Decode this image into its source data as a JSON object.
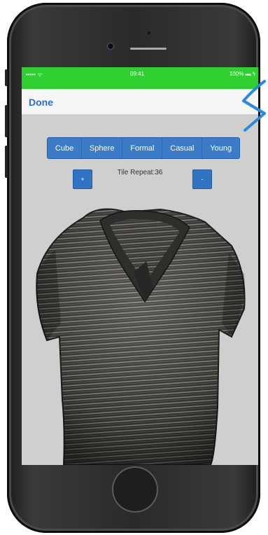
{
  "status_bar": {
    "carrier": "••••• ᯤ",
    "time": "09:41",
    "battery": "100% ▬ ϟ"
  },
  "nav": {
    "done_label": "Done"
  },
  "segments": [
    "Cube",
    "Sphere",
    "Formal",
    "Casual",
    "Young"
  ],
  "tile": {
    "increment_label": "+",
    "decrement_label": "-",
    "repeat_label": "Tile Repeat:36"
  },
  "colors": {
    "status_bar": "#2fd02f",
    "accent": "#2a6fd4",
    "segment_bg": "#3c7bc6",
    "viewport_bg": "#cfcfcf"
  },
  "icons": {
    "callout": "arrow-pointer-icon",
    "model": "striped-polo-shirt-3d"
  }
}
